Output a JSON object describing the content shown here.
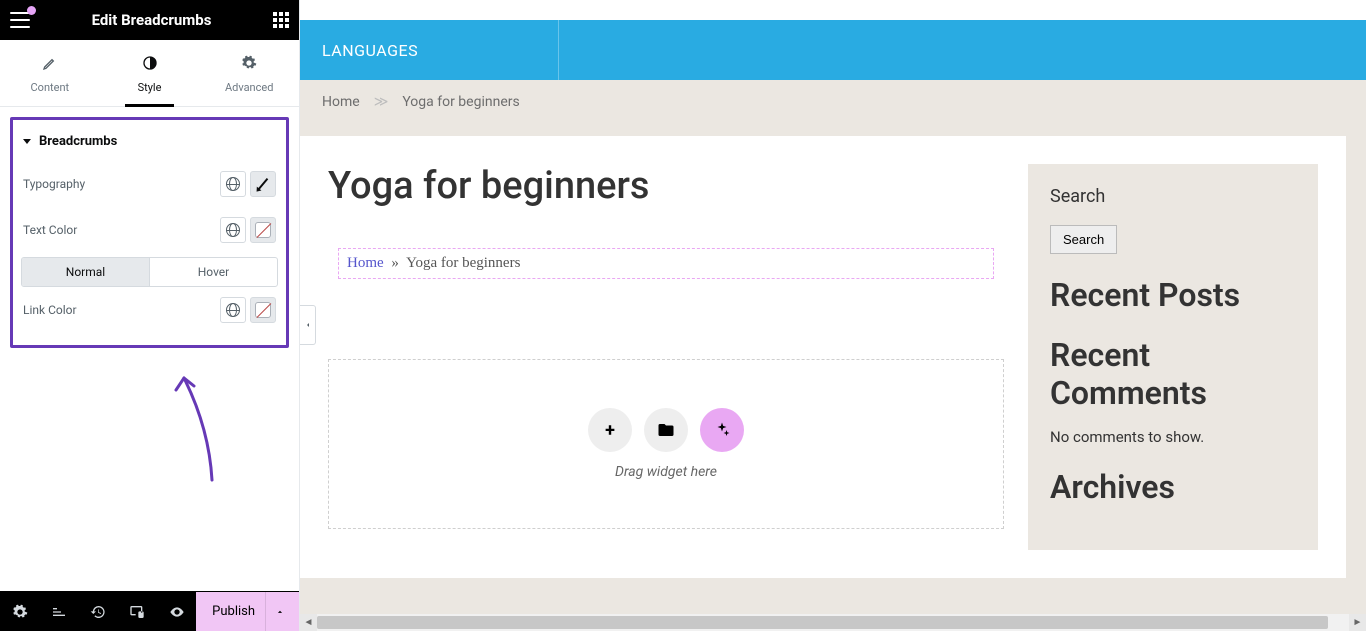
{
  "panel": {
    "title": "Edit Breadcrumbs",
    "tabs": [
      {
        "label": "Content"
      },
      {
        "label": "Style"
      },
      {
        "label": "Advanced"
      }
    ],
    "section_title": "Breadcrumbs",
    "controls": {
      "typography": "Typography",
      "text_color": "Text Color",
      "link_color": "Link Color",
      "states": {
        "normal": "Normal",
        "hover": "Hover"
      }
    },
    "footer": {
      "publish": "Publish"
    }
  },
  "preview": {
    "lang_bar": "LANGUAGES",
    "breadcrumb": {
      "home": "Home",
      "current": "Yoga for beginners"
    },
    "title": "Yoga for beginners",
    "widget_breadcrumb": {
      "home": "Home",
      "sep": "»",
      "current": "Yoga for beginners"
    },
    "drop_text": "Drag widget here",
    "sidebar": {
      "search_title": "Search",
      "search_button": "Search",
      "recent_posts": "Recent Posts",
      "recent_comments": "Recent Comments",
      "no_comments": "No comments to show.",
      "archives": "Archives"
    }
  }
}
